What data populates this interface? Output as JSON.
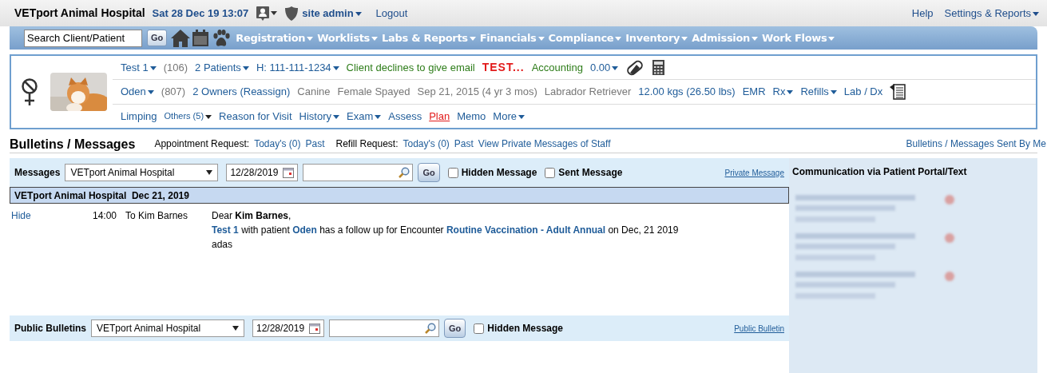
{
  "top_bar": {
    "title": "VETport Animal Hospital",
    "datetime": "Sat 28 Dec 19 13:07",
    "user": "site admin",
    "logout": "Logout",
    "help": "Help",
    "settings": "Settings & Reports"
  },
  "nav": {
    "search_placeholder": "Search Client/Patient",
    "go": "Go",
    "menus": [
      "Registration",
      "Worklists",
      "Labs & Reports",
      "Financials",
      "Compliance",
      "Inventory",
      "Admission",
      "Work Flows"
    ]
  },
  "patient": {
    "lines": [
      {
        "items": [
          {
            "text": "Test 1",
            "kind": "link",
            "caret": true
          },
          {
            "text": "(106)",
            "kind": "muted",
            "caret": false
          },
          {
            "text": "2 Patients",
            "kind": "link",
            "caret": true
          },
          {
            "text": "H: 111-111-1234",
            "kind": "link",
            "caret": true
          },
          {
            "text": "Client declines to give email",
            "kind": "success",
            "caret": false
          },
          {
            "text": "TEST...",
            "kind": "alert",
            "caret": false
          },
          {
            "text": "Accounting",
            "kind": "success",
            "caret": false
          },
          {
            "text": "0.00",
            "kind": "link",
            "caret": true
          }
        ]
      },
      {
        "items": [
          {
            "text": "Oden",
            "kind": "link",
            "caret": true
          },
          {
            "text": "(807)",
            "kind": "muted",
            "caret": false
          },
          {
            "text": "2 Owners (Reassign)",
            "kind": "link",
            "caret": false
          },
          {
            "text": "Canine",
            "kind": "muted",
            "caret": false
          },
          {
            "text": "Female Spayed",
            "kind": "muted",
            "caret": false
          },
          {
            "text": "Sep 21, 2015 (4 yr 3 mos)",
            "kind": "muted",
            "caret": false
          },
          {
            "text": "Labrador Retriever",
            "kind": "muted",
            "caret": false
          },
          {
            "text": "12.00 kgs (26.50 lbs)",
            "kind": "link",
            "caret": false
          },
          {
            "text": "EMR",
            "kind": "link",
            "caret": false
          },
          {
            "text": "Rx",
            "kind": "link",
            "caret": true
          },
          {
            "text": "Refills",
            "kind": "link",
            "caret": true
          },
          {
            "text": "Lab / Dx",
            "kind": "link",
            "caret": false
          }
        ]
      },
      {
        "items": [
          {
            "text": "Limping",
            "kind": "link",
            "caret": false
          },
          {
            "text": "Others (5)",
            "kind": "small",
            "caret": true
          },
          {
            "text": "Reason for Visit",
            "kind": "link",
            "caret": false
          },
          {
            "text": "History",
            "kind": "link",
            "caret": true
          },
          {
            "text": "Exam",
            "kind": "link",
            "caret": true
          },
          {
            "text": "Assess",
            "kind": "link",
            "caret": false
          },
          {
            "text": "Plan",
            "kind": "active",
            "caret": false
          },
          {
            "text": "Memo",
            "kind": "link",
            "caret": false
          },
          {
            "text": "More",
            "kind": "link",
            "caret": true
          }
        ]
      }
    ]
  },
  "bulletins": {
    "title": "Bulletins / Messages",
    "links": [
      {
        "text": "Appointment Request:",
        "kind": "label"
      },
      {
        "text": "Today's (0)",
        "kind": "link"
      },
      {
        "text": "Past",
        "kind": "link"
      },
      {
        "text": "Refill Request:",
        "kind": "label"
      },
      {
        "text": "Today's (0)",
        "kind": "link"
      },
      {
        "text": "Past",
        "kind": "link"
      },
      {
        "text": "View Private Messages of Staff",
        "kind": "link"
      }
    ],
    "sent_by_me": "Bulletins / Messages Sent By Me"
  },
  "messages_filter": {
    "label": "Messages",
    "clinic": "VETport Animal Hospital",
    "date": "12/28/2019",
    "go": "Go",
    "checks": [
      {
        "label": "Hidden Message",
        "checked": false
      },
      {
        "label": "Sent Message",
        "checked": false
      }
    ],
    "link": "Private Message"
  },
  "message_group": {
    "header": "VETport Animal Hospital  Dec 21, 2019",
    "hide": "Hide",
    "time": "14:00",
    "to": "To Kim Barnes",
    "greeting": "Dear **Kim Barnes**,",
    "body": "**Test 1** with patient **Oden** has a follow up for Encounter **Routine Vaccination - Adult Annual** on Dec, 21 2019",
    "note": "adas"
  },
  "public_filter": {
    "label": "Public Bulletins",
    "clinic": "VETport Animal Hospital",
    "date": "12/28/2019",
    "go": "Go",
    "checks": [
      {
        "label": "Hidden Message",
        "checked": false
      }
    ],
    "link": "Public Bulletin"
  },
  "portal": {
    "title": "Communication via Patient Portal/Text"
  }
}
